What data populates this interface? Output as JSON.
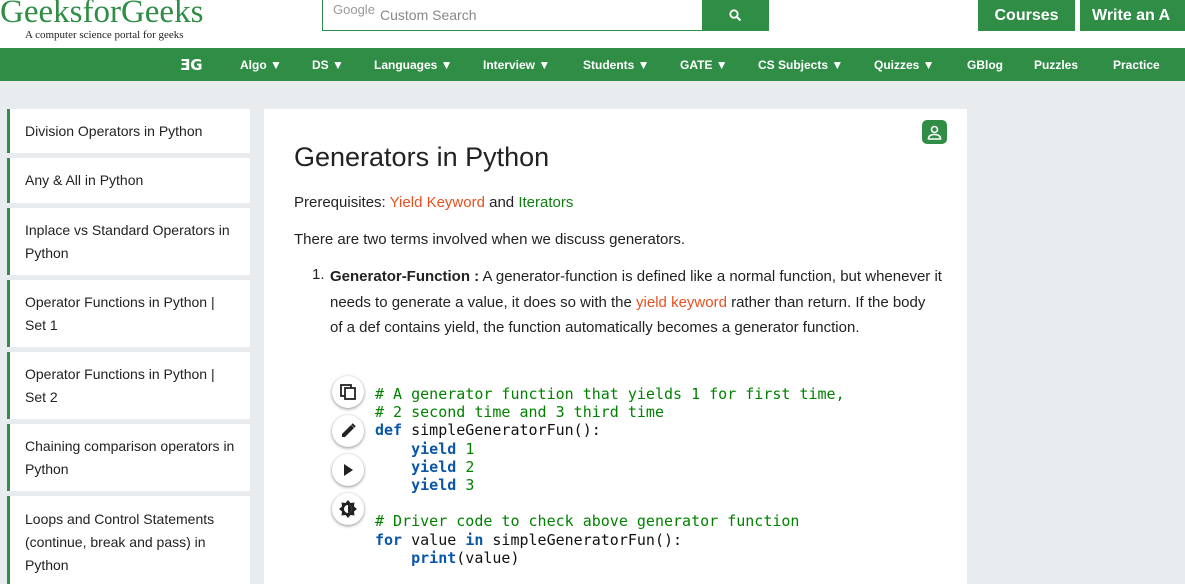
{
  "brand": {
    "logo": "GeeksforGeeks",
    "tagline": "A computer science portal for geeks",
    "color": "#2f8d46"
  },
  "search": {
    "placeholder_brand": "Google",
    "placeholder": "Custom Search",
    "button_icon": "search-icon"
  },
  "header_buttons": {
    "courses": "Courses",
    "write": "Write an A"
  },
  "nav": {
    "logo": "ƎG",
    "items": [
      "Algo ▼",
      "DS ▼",
      "Languages ▼",
      "Interview ▼",
      "Students ▼",
      "GATE ▼",
      "CS Subjects ▼",
      "Quizzes ▼",
      "GBlog",
      "Puzzles",
      "Practice"
    ]
  },
  "sidebar": {
    "items": [
      "Division Operators in Python",
      "Any & All in Python",
      "Inplace vs Standard Operators in Python",
      "Operator Functions in Python | Set 1",
      "Operator Functions in Python | Set 2",
      "Chaining comparison operators in Python",
      "Loops and Control Statements (continue, break and pass) in Python"
    ]
  },
  "article": {
    "title": "Generators in Python",
    "prereq_label": "Prerequisites: ",
    "prereq_link1": "Yield Keyword",
    "prereq_and": " and ",
    "prereq_link2": "Iterators",
    "intro": "There are two terms involved when we discuss generators.",
    "list_num": "1.",
    "item_term": "Generator-Function :",
    "item_text_a": " A generator-function is defined like a normal function, but when­ever it needs to generate a value, it does so with the ",
    "item_link": "yield keyword",
    "item_text_b": " rather than return. If the body of a def contains yield, the function automatically becomes a generator func­tion.",
    "code_tools": [
      "copy-icon",
      "edit-icon",
      "run-icon",
      "theme-icon"
    ]
  },
  "code": {
    "comment1": "# A generator function that yields 1 for first time,",
    "comment2": "# 2 second time and 3 third time",
    "def_kw": "def",
    "def_rest": " simpleGeneratorFun():",
    "yield_kw": "yield",
    "n1": "1",
    "n2": "2",
    "n3": "3",
    "comment3": "# Driver code to check above generator function",
    "for_kw": "for",
    "for_mid": " value ",
    "in_kw": "in",
    "for_rest": " simpleGeneratorFun():",
    "print_kw": "print",
    "print_rest": "(value)"
  }
}
